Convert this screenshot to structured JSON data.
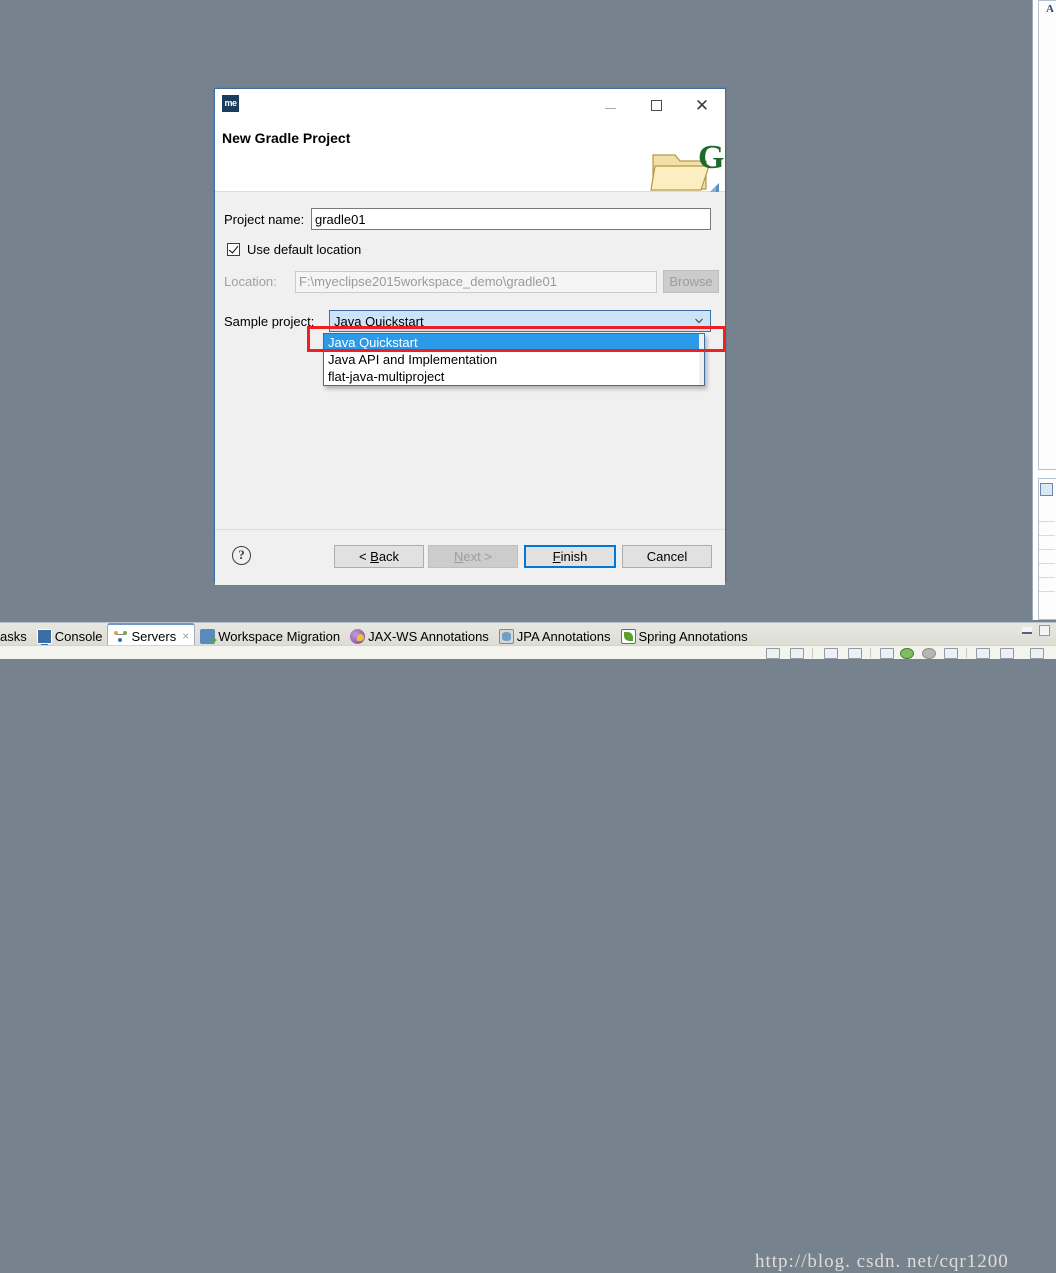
{
  "desktop": {
    "background_color": "#76838f"
  },
  "dialog": {
    "app_icon_label": "me",
    "title": "New Gradle Project",
    "banner_icon": "gradle-folder-icon",
    "window_controls": {
      "minimize": "minimize-icon",
      "maximize": "maximize-icon",
      "close": "close-icon",
      "close_glyph": "✕"
    },
    "fields": {
      "project_name_label": "Project name:",
      "project_name_value": "gradle01",
      "use_default_location_label": "Use default location",
      "use_default_location_checked": true,
      "location_label": "Location:",
      "location_value": "F:\\myeclipse2015workspace_demo\\gradle01",
      "browse_label": "Browse",
      "browse_enabled": false,
      "sample_project_label": "Sample project:",
      "sample_project_value": "Java Quickstart"
    },
    "dropdown": {
      "open": true,
      "selected_index": 0,
      "highlight_color": "#2b9ae8",
      "options": [
        "Java Quickstart",
        "Java API and Implementation",
        "flat-java-multiproject"
      ]
    },
    "footer": {
      "help_label": "?",
      "back_label": "< Back",
      "back_mnemonic": "B",
      "next_label": "Next >",
      "next_mnemonic": "N",
      "next_enabled": false,
      "finish_label": "Finish",
      "finish_mnemonic": "F",
      "finish_default": true,
      "cancel_label": "Cancel"
    }
  },
  "annotation": {
    "color": "#ed2024",
    "shape": "rectangle"
  },
  "bottom_panel": {
    "tabs": [
      {
        "label": "asks",
        "icon": "tasks-icon",
        "active": false,
        "closable": false
      },
      {
        "label": "Console",
        "icon": "console-icon",
        "active": false,
        "closable": false
      },
      {
        "label": "Servers",
        "icon": "servers-icon",
        "active": true,
        "closable": true,
        "close_glyph": "×"
      },
      {
        "label": "Workspace Migration",
        "icon": "workspace-migration-icon",
        "active": false,
        "closable": false
      },
      {
        "label": "JAX-WS Annotations",
        "icon": "jaxws-icon",
        "active": false,
        "closable": false
      },
      {
        "label": "JPA Annotations",
        "icon": "jpa-icon",
        "active": false,
        "closable": false
      },
      {
        "label": "Spring Annotations",
        "icon": "spring-icon",
        "active": false,
        "closable": false
      }
    ]
  },
  "watermark": {
    "text": "http://blog. csdn. net/cqr1200",
    "color": "#e0ddd6"
  }
}
